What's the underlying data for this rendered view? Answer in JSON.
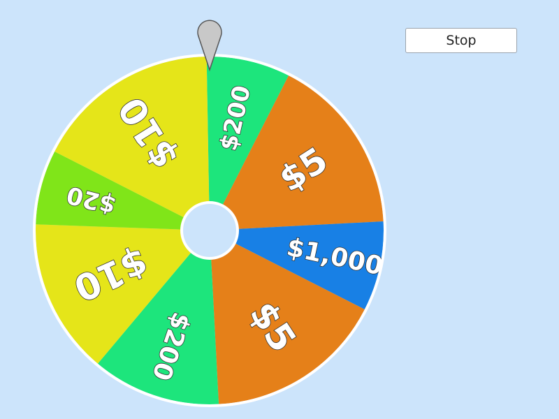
{
  "controls": {
    "stop_label": "Stop"
  },
  "wheel": {
    "segments": [
      {
        "label": "$200",
        "color": "#1de57c"
      },
      {
        "label": "$5",
        "color": "#e58019"
      },
      {
        "label": "$1,000",
        "color": "#1880e5"
      },
      {
        "label": "$5",
        "color": "#e58019"
      },
      {
        "label": "$200",
        "color": "#1de57c"
      },
      {
        "label": "$10",
        "color": "#e5e519"
      },
      {
        "label": "$20",
        "color": "#80e519"
      },
      {
        "label": "$10",
        "color": "#e5e519"
      }
    ],
    "border_color": "#ffffff",
    "hub_color": "#cce4fb",
    "pointer_color": "#c8c8c8"
  }
}
